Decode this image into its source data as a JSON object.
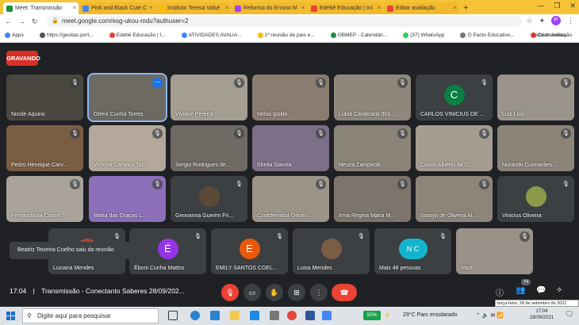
{
  "browser": {
    "tabs": [
      {
        "label": "Meet: Transmissão",
        "color": "#1e8e3e",
        "active": true
      },
      {
        "label": "Pink and Black Cute C",
        "color": "#4285f4",
        "active": false
      },
      {
        "label": "Instituto Teresa Valsé",
        "color": "#fbbc04",
        "active": false
      },
      {
        "label": "Reforma do Ensino M",
        "color": "#a142f4",
        "active": false
      },
      {
        "label": "Edebê Educação | Iní",
        "color": "#ea4335",
        "active": false
      },
      {
        "label": "Editar avaliação",
        "color": "#ea4335",
        "active": false
      }
    ],
    "new_tab": "+",
    "url": "meet.google.com/esg-ukou-mdu?authuser=2",
    "profile_initial": "P",
    "bookmarks": [
      "Apps",
      "https://gasitao.port...",
      "Edebê Educação | I...",
      "ATIVIDADES AVALIA...",
      "1ª reunião de pais e...",
      "OBMEP - Calendári...",
      "(37) WhatsApp",
      "O Pacto Educativo...",
      "Criar avaliação"
    ],
    "reading_list": "Lista de leitura"
  },
  "meet": {
    "recording_label": "GRAVANDO",
    "participants": [
      {
        "name": "Nicole Aquino",
        "bg": "#4a4640"
      },
      {
        "name": "Orleni Cunha Torres",
        "bg": "#6d6a62",
        "selected": true
      },
      {
        "name": "Viviane Pereira",
        "bg": "#a49d92"
      },
      {
        "name": "Nelsa Ipolito",
        "bg": "#8a7c6e"
      },
      {
        "name": "Lubia Cavalcanti INS...",
        "bg": "#8f877b"
      },
      {
        "name": "CARLOS VINICIUS DE ...",
        "bg": "#3c4043",
        "avatar": "C",
        "avatar_color": "#0b8043"
      },
      {
        "name": "Luiz Luiz",
        "bg": "#9a948a"
      },
      {
        "name": "Pedro Henrique Carv...",
        "bg": "#7a5e44"
      },
      {
        "name": "Victoria Campos Tar...",
        "bg": "#b3a89a"
      },
      {
        "name": "Sergio Rodrigues de...",
        "bg": "#6f6a63"
      },
      {
        "name": "Sheila Gavola",
        "bg": "#7d6f88"
      },
      {
        "name": "Neuza Zampirolli",
        "bg": "#8a8378"
      },
      {
        "name": "Carlos Alberto da C...",
        "bg": "#a49c90"
      },
      {
        "name": "Norando Guimarães ...",
        "bg": "#8c8478"
      },
      {
        "name": "Fernanda da Conce...",
        "bg": "#a9a39a"
      },
      {
        "name": "Maria das Graças L...",
        "bg": "#8c6fb8"
      },
      {
        "name": "Geovanna Guerim Fri...",
        "bg": "#3c4043",
        "avatar": "",
        "avatar_color": "#5c4a38"
      },
      {
        "name": "Coordenador Geral I...",
        "bg": "#9c9488"
      },
      {
        "name": "Irma Regina Maria M...",
        "bg": "#7d756b"
      },
      {
        "name": "Soraya de Oliveira Al...",
        "bg": "#8e857a"
      },
      {
        "name": "Vinicius Oliveira",
        "bg": "#3c4043",
        "avatar": "",
        "avatar_color": "#8a9a4a"
      },
      {
        "name": "Luciana Mendes",
        "bg": "#3c4043",
        "avatar": "",
        "avatar_color": "#b0462e"
      },
      {
        "name": "Ëboni Cunha Mattos",
        "bg": "#3c4043",
        "avatar": "É",
        "avatar_color": "#9334e6"
      },
      {
        "name": "EMILY SANTOS COEL...",
        "bg": "#3c4043",
        "avatar": "E",
        "avatar_color": "#e8590c"
      },
      {
        "name": "Luisa Mendes",
        "bg": "#3c4043",
        "avatar": "",
        "avatar_color": "#7a5e44"
      },
      {
        "name": "Mais 48 pessoas",
        "bg": "#3c4043",
        "avatar": "N C",
        "avatar_color": "#12b5cb"
      },
      {
        "name": "Você",
        "bg": "#9a9288"
      }
    ],
    "toast": "Beatriz Teixeira Coelho saiu da reunião",
    "time": "17:04",
    "separator": "|",
    "meeting_title": "Transmissão - Conectanto Saberes 28/09/202...",
    "people_count": "74"
  },
  "taskbar": {
    "search_placeholder": "Digite aqui para pesquisar",
    "battery": "50%",
    "weather": "29°C  Parc ensolarado",
    "time": "17:04",
    "date": "28/09/2021",
    "tooltip": "terça-feira, 28 de setembro de 2021"
  }
}
